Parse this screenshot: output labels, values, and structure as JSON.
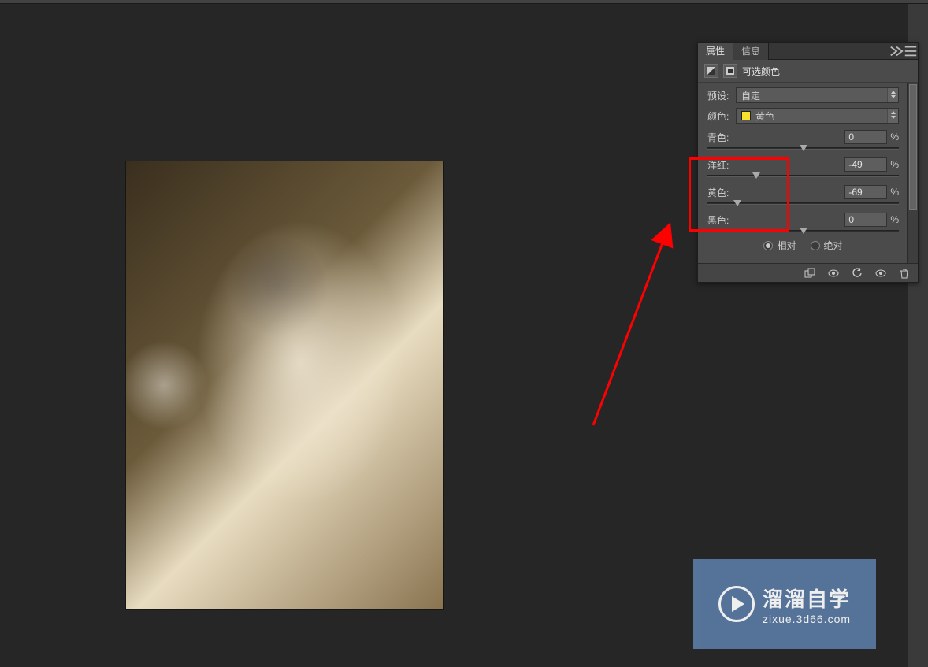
{
  "tabs": {
    "properties": "属性",
    "info": "信息"
  },
  "panel": {
    "title": "可选颜色",
    "preset_label": "预设:",
    "preset_value": "自定",
    "color_label": "颜色:",
    "color_value": "黄色",
    "color_swatch": "#F9E02C",
    "sliders": {
      "cyan": {
        "label": "青色:",
        "value": "0",
        "pos": 50
      },
      "magenta": {
        "label": "洋红:",
        "value": "-49",
        "pos": 25.5
      },
      "yellow": {
        "label": "黄色:",
        "value": "-69",
        "pos": 15.5
      },
      "black": {
        "label": "黑色:",
        "value": "0",
        "pos": 50
      }
    },
    "method": {
      "relative": "相对",
      "absolute": "绝对",
      "selected": "relative"
    },
    "pct": "%"
  },
  "watermark": {
    "line1": "溜溜自学",
    "line2": "zixue.3d66.com"
  }
}
